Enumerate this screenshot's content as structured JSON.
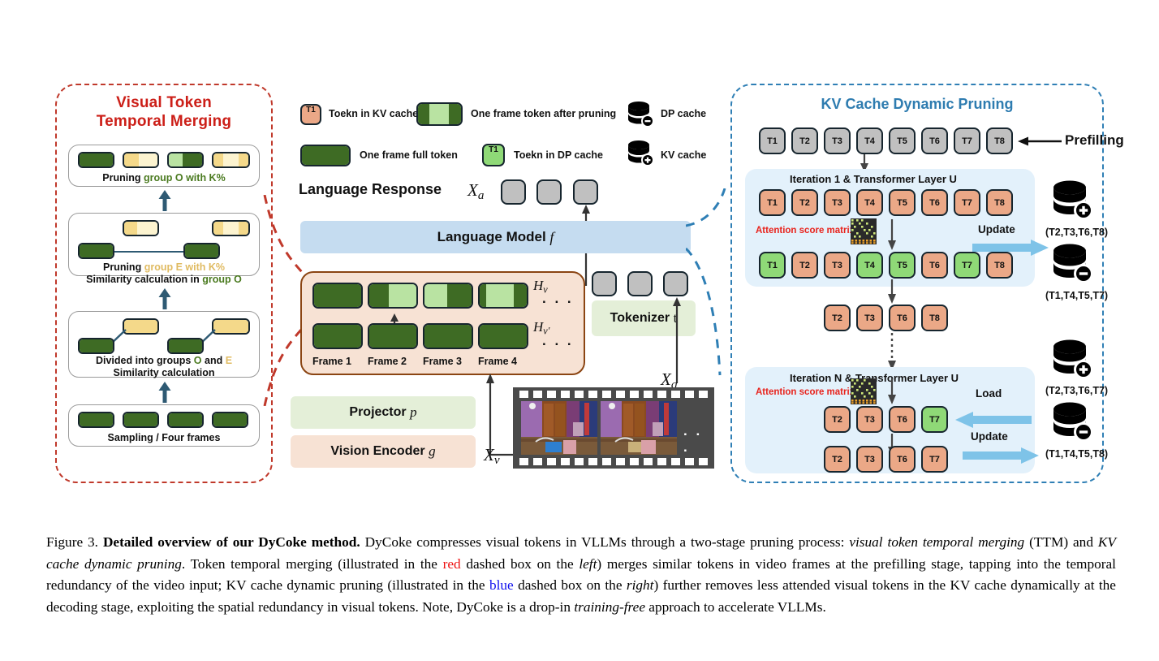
{
  "figure": {
    "number": "Figure 3.",
    "title": "Detailed overview of our DyCoke method.",
    "caption_parts": [
      {
        "t": "Figure 3. ",
        "style": "normal"
      },
      {
        "t": "Detailed overview of our DyCoke method.",
        "style": "bold"
      },
      {
        "t": " DyCoke compresses visual tokens in VLLMs through a two-stage pruning process: ",
        "style": "normal"
      },
      {
        "t": "visual token temporal merging",
        "style": "italic"
      },
      {
        "t": " (TTM) and ",
        "style": "normal"
      },
      {
        "t": "KV cache dynamic pruning",
        "style": "italic"
      },
      {
        "t": ". Token temporal merging (illustrated in the ",
        "style": "normal"
      },
      {
        "t": "red",
        "style": "red"
      },
      {
        "t": " dashed box on the ",
        "style": "normal"
      },
      {
        "t": "left",
        "style": "italic"
      },
      {
        "t": ") merges similar tokens in video frames at the prefilling stage, tapping into the temporal redundancy of the video input; KV cache dynamic pruning (illustrated in the ",
        "style": "normal"
      },
      {
        "t": "blue",
        "style": "blue"
      },
      {
        "t": " dashed box on the ",
        "style": "normal"
      },
      {
        "t": "right",
        "style": "italic"
      },
      {
        "t": ") further removes less attended visual tokens in the KV cache dynamically at the decoding stage, exploiting the spatial redundancy in visual tokens. Note, DyCoke is a drop-in ",
        "style": "normal"
      },
      {
        "t": "training-free",
        "style": "italic"
      },
      {
        "t": " approach to accelerate VLLMs.",
        "style": "normal"
      }
    ]
  },
  "left_panel": {
    "title_line1": "Visual Token",
    "title_line2": "Temporal Merging",
    "border_color": "#c0392b",
    "title_color": "#cc1f18",
    "stages": [
      {
        "id": "prune-group-o",
        "caption_segments": [
          {
            "t": "Pruning ",
            "color": "#111111"
          },
          {
            "t": "group O",
            "color": "#4a7a1f"
          },
          {
            "t": " with K%",
            "color": "#4a7a1f"
          }
        ],
        "caption_plain": "Pruning group O with K%"
      },
      {
        "id": "prune-group-e",
        "caption_line1_segments": [
          {
            "t": "Pruning ",
            "color": "#111111"
          },
          {
            "t": "group E with K%",
            "color": "#e0bb62"
          }
        ],
        "caption_line2_segments": [
          {
            "t": "Similarity calculation in ",
            "color": "#111111"
          },
          {
            "t": "group O",
            "color": "#4a7a1f"
          }
        ],
        "caption_plain_1": "Pruning group E with K%",
        "caption_plain_2": "Similarity calculation in group O"
      },
      {
        "id": "divided-groups",
        "caption_line1_segments": [
          {
            "t": "Divided into groups ",
            "color": "#111111"
          },
          {
            "t": "O",
            "color": "#4a7a1f"
          },
          {
            "t": " and ",
            "color": "#111111"
          },
          {
            "t": "E",
            "color": "#e0bb62"
          }
        ],
        "caption_line2_segments": [
          {
            "t": "Similarity calculation",
            "color": "#111111"
          }
        ],
        "caption_plain_1": "Divided into groups O and E",
        "caption_plain_2": "Similarity calculation"
      },
      {
        "id": "sampling",
        "caption_plain": "Sampling / Four frames"
      }
    ]
  },
  "legend": {
    "items": [
      {
        "icon": "token-chip-orange",
        "label": "Toekn in KV cache",
        "chip_text": "T1"
      },
      {
        "icon": "frame-token-pruned",
        "label": "One frame token after pruning",
        "chip_text": ""
      },
      {
        "icon": "dp-cache-db",
        "label": "DP cache",
        "chip_text": ""
      },
      {
        "icon": "frame-full-token",
        "label": "One frame full token",
        "chip_text": ""
      },
      {
        "icon": "token-chip-green",
        "label": "Toekn in DP cache",
        "chip_text": "T1"
      },
      {
        "icon": "kv-cache-db",
        "label": "KV cache",
        "chip_text": ""
      }
    ]
  },
  "center": {
    "language_response_label": "Language Response",
    "language_response_symbol": "X",
    "language_response_sub": "a",
    "language_model_label": "Language Model",
    "language_model_symbol": "f",
    "projector_label": "Projector",
    "projector_symbol": "p",
    "vision_encoder_label": "Vision Encoder",
    "vision_encoder_symbol": "g",
    "tokenizer_label": "Tokenizer",
    "tokenizer_symbol": "t",
    "xv_symbol": "X",
    "xv_sub": "v",
    "xq_symbol": "X",
    "xq_sub": "q",
    "hv_symbol": "H",
    "hv_sub": "v",
    "hvp_symbol": "H",
    "hvp_sub": "v'",
    "frames": [
      "Frame 1",
      "Frame 2",
      "Frame 3",
      "Frame 4"
    ],
    "ellipsis": ". . ."
  },
  "right_panel": {
    "title": "KV Cache Dynamic Pruning",
    "border_color": "#2f7fb5",
    "title_color": "#2e7cb0",
    "prefilling_label": "Prefilling",
    "prefill_tokens": [
      "T1",
      "T2",
      "T3",
      "T4",
      "T5",
      "T6",
      "T7",
      "T8"
    ],
    "iteration1": {
      "label": "Iteration 1 & Transformer Layer U",
      "attention_label": "Attention score matrix",
      "row1_tokens": [
        "T1",
        "T2",
        "T3",
        "T4",
        "T5",
        "T6",
        "T7",
        "T8"
      ],
      "row2_tokens": [
        {
          "t": "T1",
          "state": "dp"
        },
        {
          "t": "T2",
          "state": "kv"
        },
        {
          "t": "T3",
          "state": "kv"
        },
        {
          "t": "T4",
          "state": "dp"
        },
        {
          "t": "T5",
          "state": "dp"
        },
        {
          "t": "T6",
          "state": "kv"
        },
        {
          "t": "T7",
          "state": "dp"
        },
        {
          "t": "T8",
          "state": "kv"
        }
      ],
      "row3_tokens": [
        "T2",
        "T3",
        "T6",
        "T8"
      ],
      "update_label": "Update"
    },
    "iterationN": {
      "label": "Iteration N & Transformer Layer U",
      "attention_label": "Attention score matrix",
      "row1_tokens": [
        {
          "t": "T2",
          "state": "kv"
        },
        {
          "t": "T3",
          "state": "kv"
        },
        {
          "t": "T6",
          "state": "kv"
        },
        {
          "t": "T7",
          "state": "dp"
        }
      ],
      "row2_tokens": [
        "T2",
        "T3",
        "T6",
        "T7"
      ],
      "load_label": "Load",
      "update_label": "Update"
    },
    "caches": [
      {
        "id": "kv-cache-1",
        "type": "plus",
        "label": "(T2,T3,T6,T8)"
      },
      {
        "id": "dp-cache-1",
        "type": "minus",
        "label": "(T1,T4,T5,T7)"
      },
      {
        "id": "kv-cache-2",
        "type": "plus",
        "label": "(T2,T3,T6,T7)"
      },
      {
        "id": "dp-cache-2",
        "type": "minus",
        "label": "(T1,T4,T5,T8)"
      }
    ]
  },
  "colors": {
    "token_kv": "#eba887",
    "token_dp": "#8fd977",
    "token_gray": "#c0c0c0",
    "frame_full": "#3e6b24",
    "frame_pruned": "#b9e3a2",
    "group_o": "#4a7a1f",
    "group_e": "#e0bb62",
    "lm_blue": "#c5dcf0",
    "vis_peach": "#f7e2d4",
    "proj_green": "#e4efd8",
    "iter_blue": "#e3f1fb",
    "arrow_blue": "#7ec3e8",
    "red_dash": "#c0392b",
    "blue_dash": "#2f7fb5",
    "attn_red": "#e8231c"
  }
}
